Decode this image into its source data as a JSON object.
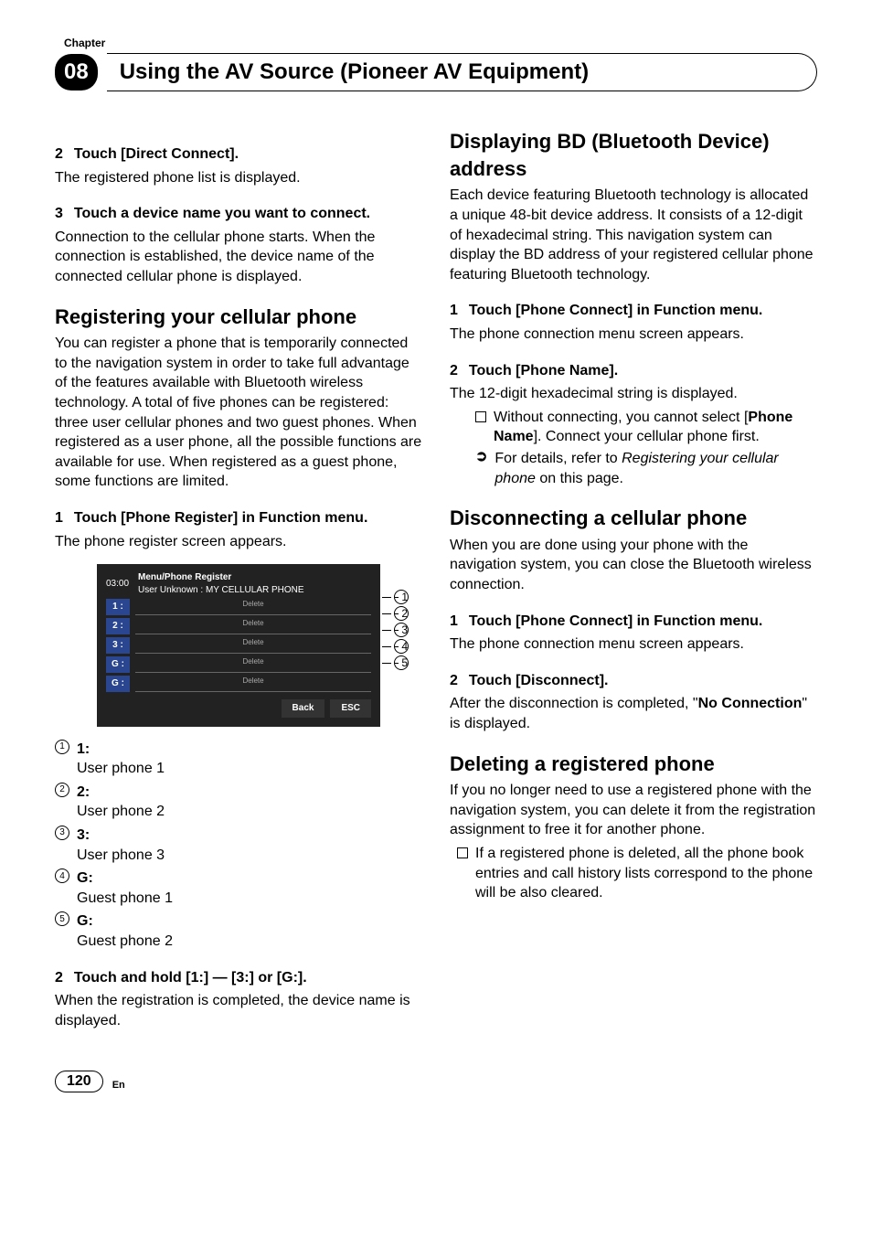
{
  "header": {
    "chapter_label": "Chapter",
    "chapter_num": "08",
    "title": "Using the AV Source (Pioneer AV Equipment)"
  },
  "left": {
    "s2_head": "Touch [Direct Connect].",
    "s2_body": "The registered phone list is displayed.",
    "s3_head": "Touch a device name you want to connect.",
    "s3_body": "Connection to the cellular phone starts. When the connection is established, the device name of the connected cellular phone is displayed.",
    "reg_title": "Registering your cellular phone",
    "reg_intro": "You can register a phone that is temporarily connected to the navigation system in order to take full advantage of the features available with Bluetooth wireless technology. A total of five phones can be registered: three user cellular phones and two guest phones. When registered as a user phone, all the possible functions are available for use. When registered as a guest phone, some functions are limited.",
    "reg_s1_head": "Touch [Phone Register] in Function menu.",
    "reg_s1_body": "The phone register screen appears.",
    "screen": {
      "time": "03:00",
      "menu_title": "Menu/Phone Register",
      "user_line": "User Unknown : MY CELLULAR PHONE",
      "rows": [
        {
          "idx": "1 :",
          "del": "Delete"
        },
        {
          "idx": "2 :",
          "del": "Delete"
        },
        {
          "idx": "3 :",
          "del": "Delete"
        },
        {
          "idx": "G :",
          "del": "Delete"
        },
        {
          "idx": "G :",
          "del": "Delete"
        }
      ],
      "back": "Back",
      "esc": "ESC"
    },
    "legend": [
      {
        "num": "1",
        "label": "1:",
        "body": "User phone 1"
      },
      {
        "num": "2",
        "label": "2:",
        "body": "User phone 2"
      },
      {
        "num": "3",
        "label": "3:",
        "body": "User phone 3"
      },
      {
        "num": "4",
        "label": "G:",
        "body": "Guest phone 1"
      },
      {
        "num": "5",
        "label": "G:",
        "body": "Guest phone 2"
      }
    ],
    "reg_s2_head": "Touch and hold [1:] — [3:] or [G:].",
    "reg_s2_body": "When the registration is completed, the device name is displayed."
  },
  "right": {
    "bd_title": "Displaying BD (Bluetooth Device) address",
    "bd_intro": "Each device featuring Bluetooth technology is allocated a unique 48-bit device address. It consists of a 12-digit of hexadecimal string. This navigation system can display the BD address of your registered cellular phone featuring Bluetooth technology.",
    "bd_s1_head": "Touch [Phone Connect] in Function menu.",
    "bd_s1_body": "The phone connection menu screen appears.",
    "bd_s2_head": "Touch [Phone Name].",
    "bd_s2_body": "The 12-digit hexadecimal string is displayed.",
    "bd_note1_a": "Without connecting, you cannot select [",
    "bd_note1_b": "Phone Name",
    "bd_note1_c": "]. Connect your cellular phone first.",
    "bd_note2_a": "For details, refer to ",
    "bd_note2_b": "Registering your cellular phone",
    "bd_note2_c": " on this page.",
    "disc_title": "Disconnecting a cellular phone",
    "disc_intro": "When you are done using your phone with the navigation system, you can close the Bluetooth wireless connection.",
    "disc_s1_head": "Touch [Phone Connect] in Function menu.",
    "disc_s1_body": "The phone connection menu screen appears.",
    "disc_s2_head": "Touch [Disconnect].",
    "disc_s2_body_a": "After the disconnection is completed, \"",
    "disc_s2_body_b": "No Connection",
    "disc_s2_body_c": "\" is displayed.",
    "del_title": "Deleting a registered phone",
    "del_intro": "If you no longer need to use a registered phone with the navigation system, you can delete it from the registration assignment to free it for another phone.",
    "del_note": "If a registered phone is deleted, all the phone book entries and call history lists correspond to the phone will be also cleared."
  },
  "footer": {
    "page": "120",
    "lang": "En"
  }
}
